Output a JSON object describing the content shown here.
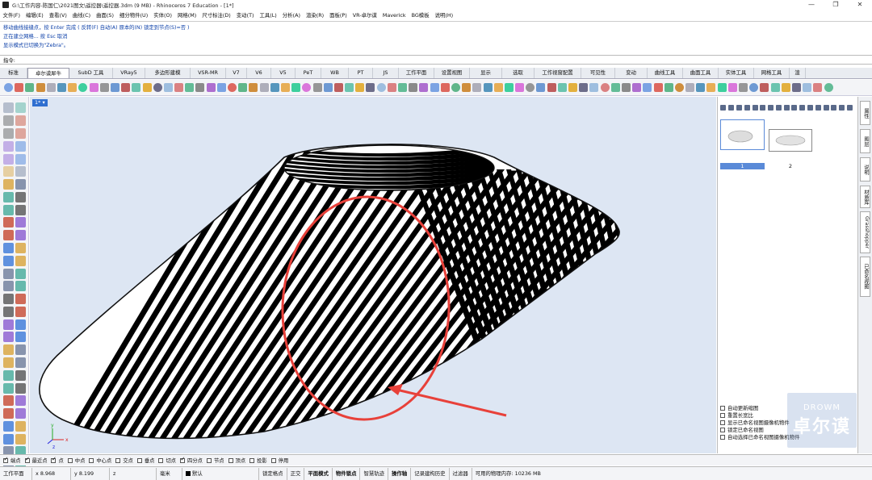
{
  "window": {
    "title": "G:\\工作内容-陈国仁\\2021图文\\遥控器\\遥控器.3dm (9 MB) - Rhinoceros 7 Education - [1*]",
    "controls": [
      "—",
      "❐",
      "✕"
    ]
  },
  "menus": [
    "文件(F)",
    "编辑(E)",
    "查看(V)",
    "曲线(C)",
    "曲面(S)",
    "细分物件(U)",
    "实体(O)",
    "网格(M)",
    "尺寸标注(D)",
    "变动(T)",
    "工具(L)",
    "分析(A)",
    "渲染(R)",
    "面板(P)",
    "VR-卓尔谟",
    "Maverick",
    "BG模板",
    "说明(H)"
  ],
  "command": {
    "history": [
      "移动曲线接缝点，按 Enter 完成 ( 反转(F)  自动(A)  原本的(N)  锁定到节点(S)=否 )",
      "正在建立网格... 按 Esc 取消",
      "显示模式已切换为\"Zebra\"。"
    ],
    "prompt": "指令:"
  },
  "tabs": [
    {
      "label": "标准",
      "w": 34
    },
    {
      "label": "卓尔谟犀牛",
      "w": 52,
      "active": true
    },
    {
      "label": "SubD 工具",
      "w": 54
    },
    {
      "label": "VRay5",
      "w": 40
    },
    {
      "label": "多边形建模",
      "w": 56
    },
    {
      "label": "VSR-MR",
      "w": 44
    },
    {
      "label": "V7",
      "w": 26
    },
    {
      "label": "V6",
      "w": 30
    },
    {
      "label": "V5",
      "w": 30
    },
    {
      "label": "PeT",
      "w": 32
    },
    {
      "label": "WB",
      "w": 34
    },
    {
      "label": "PT",
      "w": 30
    },
    {
      "label": "JS",
      "w": 32
    },
    {
      "label": "工作平面",
      "w": 44
    },
    {
      "label": "设置视图",
      "w": 44
    },
    {
      "label": "显示",
      "w": 40
    },
    {
      "label": "选取",
      "w": 40
    },
    {
      "label": "工作视窗配置",
      "w": 58
    },
    {
      "label": "可见性",
      "w": 42
    },
    {
      "label": "变动",
      "w": 40
    },
    {
      "label": "曲线工具",
      "w": 44
    },
    {
      "label": "曲面工具",
      "w": 44
    },
    {
      "label": "实体工具",
      "w": 44
    },
    {
      "label": "网格工具",
      "w": 44
    },
    {
      "label": "渲",
      "w": 20
    }
  ],
  "toolbar_icons": [
    "#3a78d8",
    "#d53a2c",
    "#4a7",
    "#c83",
    "#889",
    "#27a",
    "#e4a13a",
    "#3c9",
    "#c3c",
    "#777",
    "#58c",
    "#b55",
    "#2a8",
    "#d90",
    "#557",
    "#9bd",
    "#c44",
    "#3a7",
    "#777",
    "#a6c"
  ],
  "viewport": {
    "label": "1*"
  },
  "panel": {
    "thumbs": [
      {
        "label": "1",
        "selected": true
      },
      {
        "label": "2",
        "selected": false
      }
    ],
    "options": [
      {
        "label": "自动更新缩图",
        "checked": false
      },
      {
        "label": "重置长宽比",
        "checked": false
      },
      {
        "label": "显示已命名视图摄像机物件",
        "checked": false
      },
      {
        "label": "锁定已命名视图",
        "checked": false
      },
      {
        "label": "自动选择已命名视图摄像机物件",
        "checked": false
      }
    ]
  },
  "right_tabs": [
    "属性",
    "图层",
    "说明",
    "材质库",
    "Grasshopper",
    "已命名视图"
  ],
  "osnaps": [
    {
      "label": "端点",
      "checked": true
    },
    {
      "label": "最近点",
      "checked": true
    },
    {
      "label": "点",
      "checked": true
    },
    {
      "label": "中点",
      "checked": false
    },
    {
      "label": "中心点",
      "checked": false
    },
    {
      "label": "交点",
      "checked": false
    },
    {
      "label": "垂点",
      "checked": false
    },
    {
      "label": "切点",
      "checked": false
    },
    {
      "label": "四分点",
      "checked": true
    },
    {
      "label": "节点",
      "checked": false
    },
    {
      "label": "顶点",
      "checked": false
    },
    {
      "label": "投影",
      "checked": false
    },
    {
      "label": "停用",
      "checked": false
    }
  ],
  "status": {
    "cplane": "工作平面",
    "x": "x 8.968",
    "y": "y 8.199",
    "z": "z",
    "unit": "毫米",
    "layer": "默认",
    "toggles": [
      "锁定格点",
      "正交",
      "平面模式",
      "物件锁点",
      "智慧轨迹",
      "操作轴",
      "记录建构历史",
      "过滤器"
    ],
    "memory": "可用的物理内存: 10236 MB"
  },
  "watermark": {
    "top": "DROWM",
    "main": "卓尔谟"
  },
  "colors": {
    "annotation_red": "#e8413a",
    "viewport_bg": "#dde6f3",
    "accent": "#2f6fd0"
  }
}
